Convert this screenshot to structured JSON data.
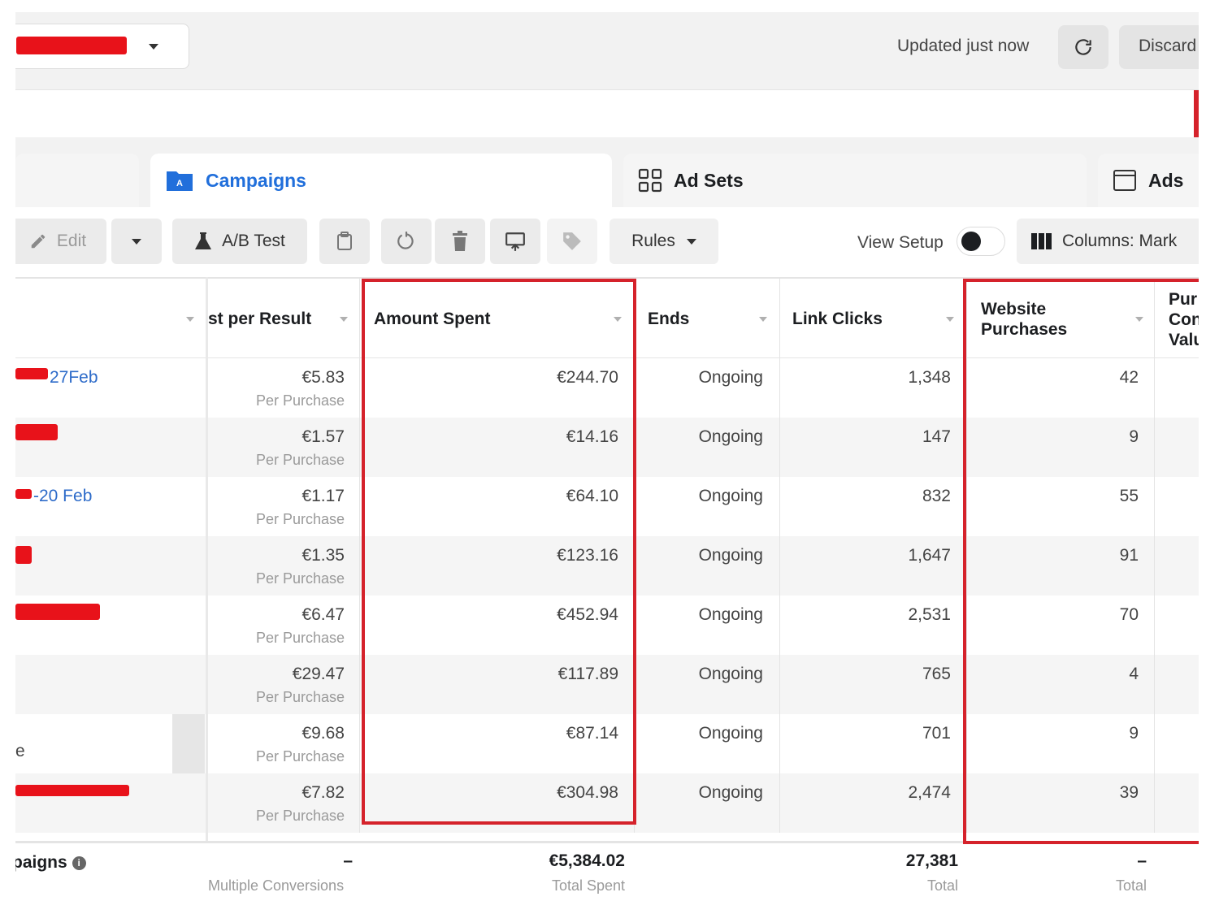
{
  "topbar": {
    "updated_text": "Updated just now",
    "discard_label": "Discard"
  },
  "tabs": {
    "campaigns": "Campaigns",
    "ad_sets": "Ad Sets",
    "ads": "Ads"
  },
  "toolbar": {
    "edit_label": "Edit",
    "ab_test_label": "A/B Test",
    "rules_label": "Rules",
    "view_setup_label": "View Setup",
    "columns_label": "Columns: Mark"
  },
  "table": {
    "headers": {
      "cost_per_result": "st per Result",
      "amount_spent": "Amount Spent",
      "ends": "Ends",
      "link_clicks": "Link Clicks",
      "website_purchases": "Website Purchases",
      "purchase_conversion_value": "Pur Con Valu"
    },
    "rows": [
      {
        "name": "27Feb",
        "cost": "€5.83",
        "cost_sub": "Per Purchase",
        "spent": "€244.70",
        "ends": "Ongoing",
        "clicks": "1,348",
        "purchases": "42"
      },
      {
        "name": "",
        "cost": "€1.57",
        "cost_sub": "Per Purchase",
        "spent": "€14.16",
        "ends": "Ongoing",
        "clicks": "147",
        "purchases": "9"
      },
      {
        "name": "-20 Feb",
        "cost": "€1.17",
        "cost_sub": "Per Purchase",
        "spent": "€64.10",
        "ends": "Ongoing",
        "clicks": "832",
        "purchases": "55"
      },
      {
        "name": "",
        "cost": "€1.35",
        "cost_sub": "Per Purchase",
        "spent": "€123.16",
        "ends": "Ongoing",
        "clicks": "1,647",
        "purchases": "91"
      },
      {
        "name": "",
        "cost": "€6.47",
        "cost_sub": "Per Purchase",
        "spent": "€452.94",
        "ends": "Ongoing",
        "clicks": "2,531",
        "purchases": "70"
      },
      {
        "name": "",
        "cost": "€29.47",
        "cost_sub": "Per Purchase",
        "spent": "€117.89",
        "ends": "Ongoing",
        "clicks": "765",
        "purchases": "4"
      },
      {
        "name": "e",
        "cost": "€9.68",
        "cost_sub": "Per Purchase",
        "spent": "€87.14",
        "ends": "Ongoing",
        "clicks": "701",
        "purchases": "9"
      },
      {
        "name": "",
        "cost": "€7.82",
        "cost_sub": "Per Purchase",
        "spent": "€304.98",
        "ends": "Ongoing",
        "clicks": "2,474",
        "purchases": "39"
      }
    ],
    "footer": {
      "label": "paigns",
      "cost": "–",
      "cost_sub": "Multiple Conversions",
      "spent": "€5,384.02",
      "spent_sub": "Total Spent",
      "clicks": "27,381",
      "clicks_sub": "Total",
      "purchases": "–",
      "purchases_sub": "Total"
    }
  },
  "colors": {
    "accent_blue": "#216fdb",
    "highlight_red": "#d5222b",
    "redaction_red": "#e8121a"
  }
}
